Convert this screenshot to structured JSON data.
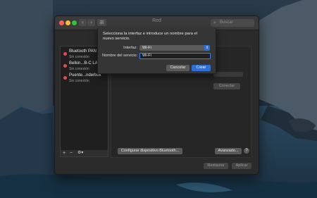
{
  "window": {
    "title": "Red",
    "search_placeholder": "Buscar"
  },
  "services": [
    {
      "name": "Bluetooth PAN",
      "status": "Sin conexión"
    },
    {
      "name": "Belkin...B-C LAN",
      "status": "Sin conexión"
    },
    {
      "name": "Puente...nderbolt",
      "status": "Sin conexión"
    }
  ],
  "sidebar_tools": {
    "add": "+",
    "remove": "−",
    "gear": "⚙▾"
  },
  "panel": {
    "connect_label": "Conectar",
    "configure_bluetooth_label": "Configurar dispositivo Bluetooth...",
    "advanced_label": "Avanzado...",
    "help_label": "?",
    "revert_label": "Restaurar",
    "apply_label": "Aplicar"
  },
  "sheet": {
    "prompt": "Selecciona la interfaz e introduce un nombre para el nuevo servicio.",
    "interface_label": "Interfaz:",
    "interface_value": "Wi-Fi",
    "service_name_label": "Nombre del servicio:",
    "service_name_value": "Wi-Fi",
    "cancel_label": "Cancelar",
    "create_label": "Crear"
  },
  "colors": {
    "accent": "#2f6fd8",
    "status_disconnected": "#e24b4b"
  }
}
